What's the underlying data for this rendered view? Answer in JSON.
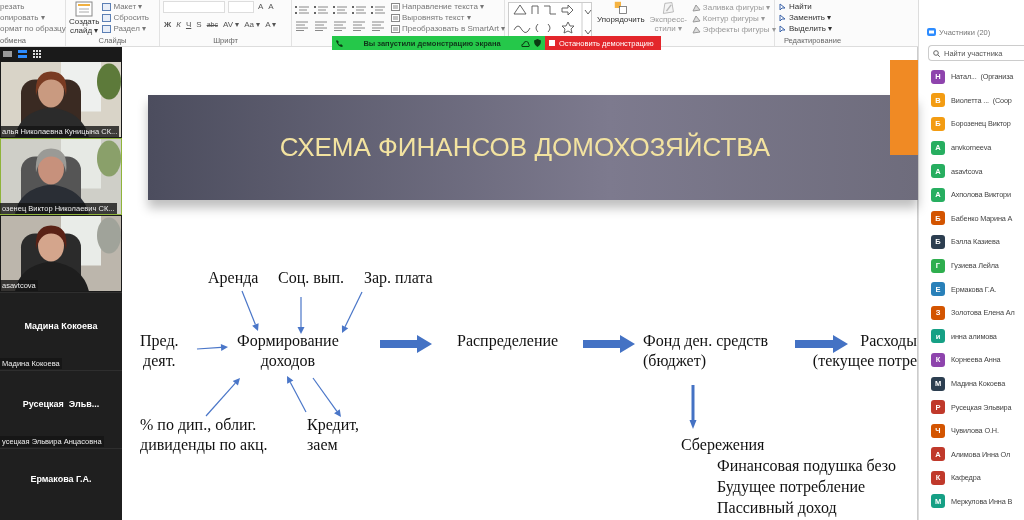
{
  "ribbon": {
    "clipboard": {
      "items": [
        "резать",
        "опировать ▾",
        "ормат по образцу"
      ],
      "label": "обмена"
    },
    "slides": {
      "new_slide": "Создать\nслайд ▾",
      "items": [
        "Макет ▾",
        "Сбросить",
        "Раздел ▾"
      ],
      "label": "Слайды"
    },
    "font": {
      "size_buttons": [
        "A",
        "A"
      ],
      "buttons": [
        "Ж",
        "К",
        "Ч",
        "S",
        "abc",
        "AV ▾",
        "Aa ▾",
        "A ▾"
      ],
      "label": "Шрифт"
    },
    "paragraph": {
      "items": [
        "Направление текста ▾",
        "Выровнять текст ▾",
        "Преобразовать в SmartArt ▾"
      ]
    },
    "drawing": {
      "arrange": "Упорядочить",
      "quick_styles": "Экспресс-\nстили ▾",
      "items": [
        "Заливка фигуры ▾",
        "Контур фигуры ▾",
        "Эффекты фигуры ▾"
      ]
    },
    "editing": {
      "items": [
        "Найти",
        "Заменить ▾",
        "Выделить ▾"
      ],
      "label": "Редактирование"
    }
  },
  "share_banner": {
    "message": "Вы запустили демонстрацию экрана",
    "stop": "Остановить демонстрацию"
  },
  "videos": [
    {
      "kind": "video",
      "name": "алья Николаевна Куницына СК...",
      "active": false
    },
    {
      "kind": "video",
      "name": "озенец Виктор Николаевич СК...",
      "active": true
    },
    {
      "kind": "video",
      "name": "asavtcova",
      "active": false
    },
    {
      "kind": "name",
      "display": "Мадина Кокоева",
      "name": "Мадина Кокоева"
    },
    {
      "kind": "name",
      "display": "Русецкая  Эльв...",
      "name": "усецкая Эльвира Анцасовна"
    },
    {
      "kind": "name",
      "display": "Ермакова Г.А."
    }
  ],
  "slide": {
    "title": "СХЕМА ФИНАНСОВ ДОМОХОЗЯЙСТВА",
    "nodes": [
      "Аренда",
      "Соц. вып.",
      "Зар. плата",
      "Пред.\nдеят.",
      "Формирование\nдоходов",
      "Распределение",
      "Фонд ден. средств\n(бюджет)",
      "Расходы",
      "(текущее потре",
      "% по дип., облиг.\nдивиденды по акц.",
      "Кредит,\nзаем",
      "Сбережения",
      "Финансовая подушка безо",
      "Будущее потребление",
      "Пассивный доход"
    ]
  },
  "participants": {
    "title": "Участники (20)",
    "search": {
      "placeholder": "Найти участника"
    },
    "items": [
      {
        "initial": "Н",
        "color": "#8e44ad",
        "name": "Натал...  (Организа"
      },
      {
        "initial": "В",
        "color": "#f39c12",
        "name": "Виолетта ...  (Соор"
      },
      {
        "initial": "Б",
        "color": "#f39c12",
        "name": "Борозенец Виктор"
      },
      {
        "initial": "A",
        "color": "#27ae60",
        "name": "anvkorneeva"
      },
      {
        "initial": "A",
        "color": "#27ae60",
        "name": "asavtcova"
      },
      {
        "initial": "А",
        "color": "#27ae60",
        "name": "Ахполова Виктори"
      },
      {
        "initial": "Б",
        "color": "#d35400",
        "name": "Бабенко Марина А"
      },
      {
        "initial": "Б",
        "color": "#2c3e50",
        "name": "Бэлла Казиева"
      },
      {
        "initial": "Г",
        "color": "#2eae4e",
        "name": "Гузиева Лейла"
      },
      {
        "initial": "Е",
        "color": "#2980b9",
        "name": "Ермакова Г.А."
      },
      {
        "initial": "З",
        "color": "#d35400",
        "name": "Золотова Елена Ал"
      },
      {
        "initial": "и",
        "color": "#16a085",
        "name": "инна алимова"
      },
      {
        "initial": "К",
        "color": "#8e44ad",
        "name": "Корнеева Анна"
      },
      {
        "initial": "М",
        "color": "#2c3e50",
        "name": "Мадина Кокоева"
      },
      {
        "initial": "Р",
        "color": "#c0392b",
        "name": "Русецкая Эльвира"
      },
      {
        "initial": "Ч",
        "color": "#d35400",
        "name": "Чувилова О.Н."
      },
      {
        "initial": "А",
        "color": "#c0392b",
        "name": "Алимова Инна Ол"
      },
      {
        "initial": "К",
        "color": "#c0392b",
        "name": "Кафедра"
      },
      {
        "initial": "М",
        "color": "#16a085",
        "name": "Меркулова Инна В"
      }
    ]
  }
}
